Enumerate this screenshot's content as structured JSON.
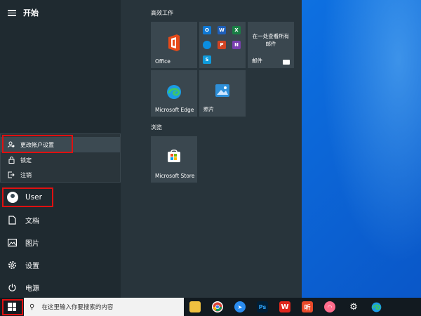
{
  "start_menu": {
    "title": "开始",
    "rail": {
      "user": "User",
      "documents": "文档",
      "pictures": "图片",
      "settings": "设置",
      "power": "电源"
    },
    "flyout": {
      "change_account": "更改帐户设置",
      "lock": "锁定",
      "sign_out": "注销"
    }
  },
  "tiles": {
    "group_productivity": "高效工作",
    "group_browse": "浏览",
    "office": "Office",
    "mail_heading": "在一处查看所有邮件",
    "mail": "邮件",
    "edge": "Microsoft Edge",
    "photos": "照片",
    "store": "Microsoft Store"
  },
  "taskbar": {
    "search_placeholder": "在这里输入你要搜索的内容",
    "apps": [
      "file-explorer",
      "chrome",
      "feishu",
      "photoshop",
      "wps",
      "itingshu",
      "app",
      "settings",
      "edge"
    ]
  },
  "colors": {
    "accent": "#0a5fd8",
    "highlight_box": "#e01010",
    "menu_bg": "#28343b"
  }
}
